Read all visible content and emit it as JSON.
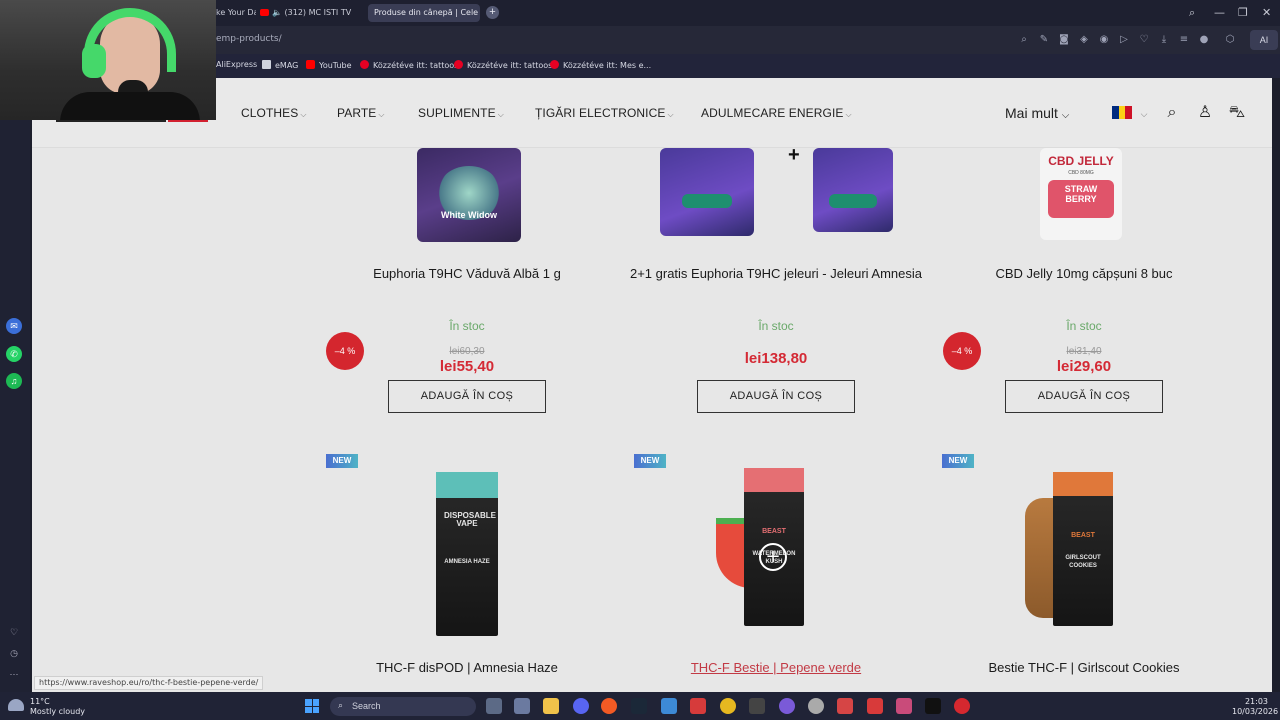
{
  "browser": {
    "tabs": [
      {
        "label": "ke Your Da"
      },
      {
        "label": "(312) MC ISTI TV"
      },
      {
        "label": "Produse din cânepă | Cele"
      }
    ],
    "url": "emp-products/",
    "ai_label": "AI",
    "bookmarks": [
      {
        "label": "AliExpress",
        "color": "#ff6a00"
      },
      {
        "label": "eMAG",
        "color": "#1a73e8"
      },
      {
        "label": "YouTube",
        "color": "#ff0000"
      },
      {
        "label": "Közzétéve itt: tattoos",
        "color": "#e60023"
      },
      {
        "label": "Közzétéve itt: tattoos",
        "color": "#e60023"
      },
      {
        "label": "Közzétéve itt: Mes e...",
        "color": "#e60023"
      }
    ]
  },
  "header": {
    "nav": [
      {
        "label": "CLOTHES"
      },
      {
        "label": "PARTE"
      },
      {
        "label": "SUPLIMENTE"
      },
      {
        "label": "ȚIGĂRI ELECTRONICE"
      },
      {
        "label": "ADULMECARE ENERGIE"
      }
    ],
    "more_label": "Mai mult",
    "accent": "#d2202f"
  },
  "products_row1": [
    {
      "name": "Euphoria T9HC Văduvă Albă 1 g",
      "stock": "În stoc",
      "old_price": "lei60,30",
      "price": "lei55,40",
      "discount": "–4 %",
      "button": "ADAUGĂ ÎN COȘ",
      "image_text": "White Widow"
    },
    {
      "name": "2+1 gratis Euphoria T9HC jeleuri - Jeleuri Amnesia",
      "stock": "În stoc",
      "price": "lei138,80",
      "button": "ADAUGĂ ÎN COȘ",
      "image_text": "+"
    },
    {
      "name": "CBD Jelly 10mg căpșuni 8 buc",
      "stock": "În stoc",
      "old_price": "lei31,40",
      "price": "lei29,60",
      "discount": "–4 %",
      "button": "ADAUGĂ ÎN COȘ",
      "image_text": {
        "brand": "CBD JELLY",
        "sub": "CBD 80MG",
        "flavor": "STRAW BERRY"
      }
    }
  ],
  "products_row2": [
    {
      "name": "THC-F disPOD | Amnesia Haze",
      "badge": "NEW",
      "pack_top": "DISPOSABLE VAPE",
      "pack_mid": "AMNESIA HAZE"
    },
    {
      "name": "THC-F Bestie | Pepene verde",
      "badge": "NEW",
      "pack_top": "BEAST",
      "pack_mid": "WATERMELON KUSH"
    },
    {
      "name": "Bestie THC-F | Girlscout Cookies",
      "badge": "NEW",
      "pack_top": "BEAST",
      "pack_mid": "GIRLSCOUT COOKIES"
    }
  ],
  "status_url": "https://www.raveshop.eu/ro/thc-f-bestie-pepene-verde/",
  "taskbar": {
    "temperature": "11°C",
    "weather": "Mostly cloudy",
    "search_placeholder": "Search",
    "time": "21:03",
    "date": "10/03/2026"
  }
}
